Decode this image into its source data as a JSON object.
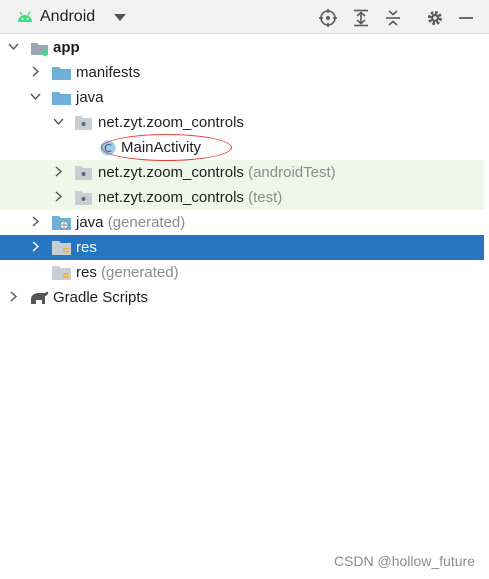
{
  "toolbar": {
    "view_label": "Android",
    "icons": [
      "android-icon",
      "dropdown-chevron-icon",
      "locate-icon",
      "expand-all-icon",
      "collapse-all-icon",
      "gear-icon",
      "minimize-icon"
    ]
  },
  "tree": {
    "app": "app",
    "manifests": "manifests",
    "java": "java",
    "pkg_main": "net.zyt.zoom_controls",
    "main_activity": "MainActivity",
    "pkg_android_test": "net.zyt.zoom_controls",
    "pkg_android_test_suffix": "(androidTest)",
    "pkg_test": "net.zyt.zoom_controls",
    "pkg_test_suffix": "(test)",
    "java_generated": "java",
    "java_generated_suffix": "(generated)",
    "res": "res",
    "res_generated": "res",
    "res_generated_suffix": "(generated)",
    "gradle_scripts": "Gradle Scripts"
  },
  "watermark": "CSDN @hollow_future",
  "colors": {
    "selection": "#2675bf",
    "test_highlight": "#eef7e8",
    "annotation": "#e0443a",
    "folder": "#6fb0d8",
    "android_green": "#3ddc84"
  }
}
